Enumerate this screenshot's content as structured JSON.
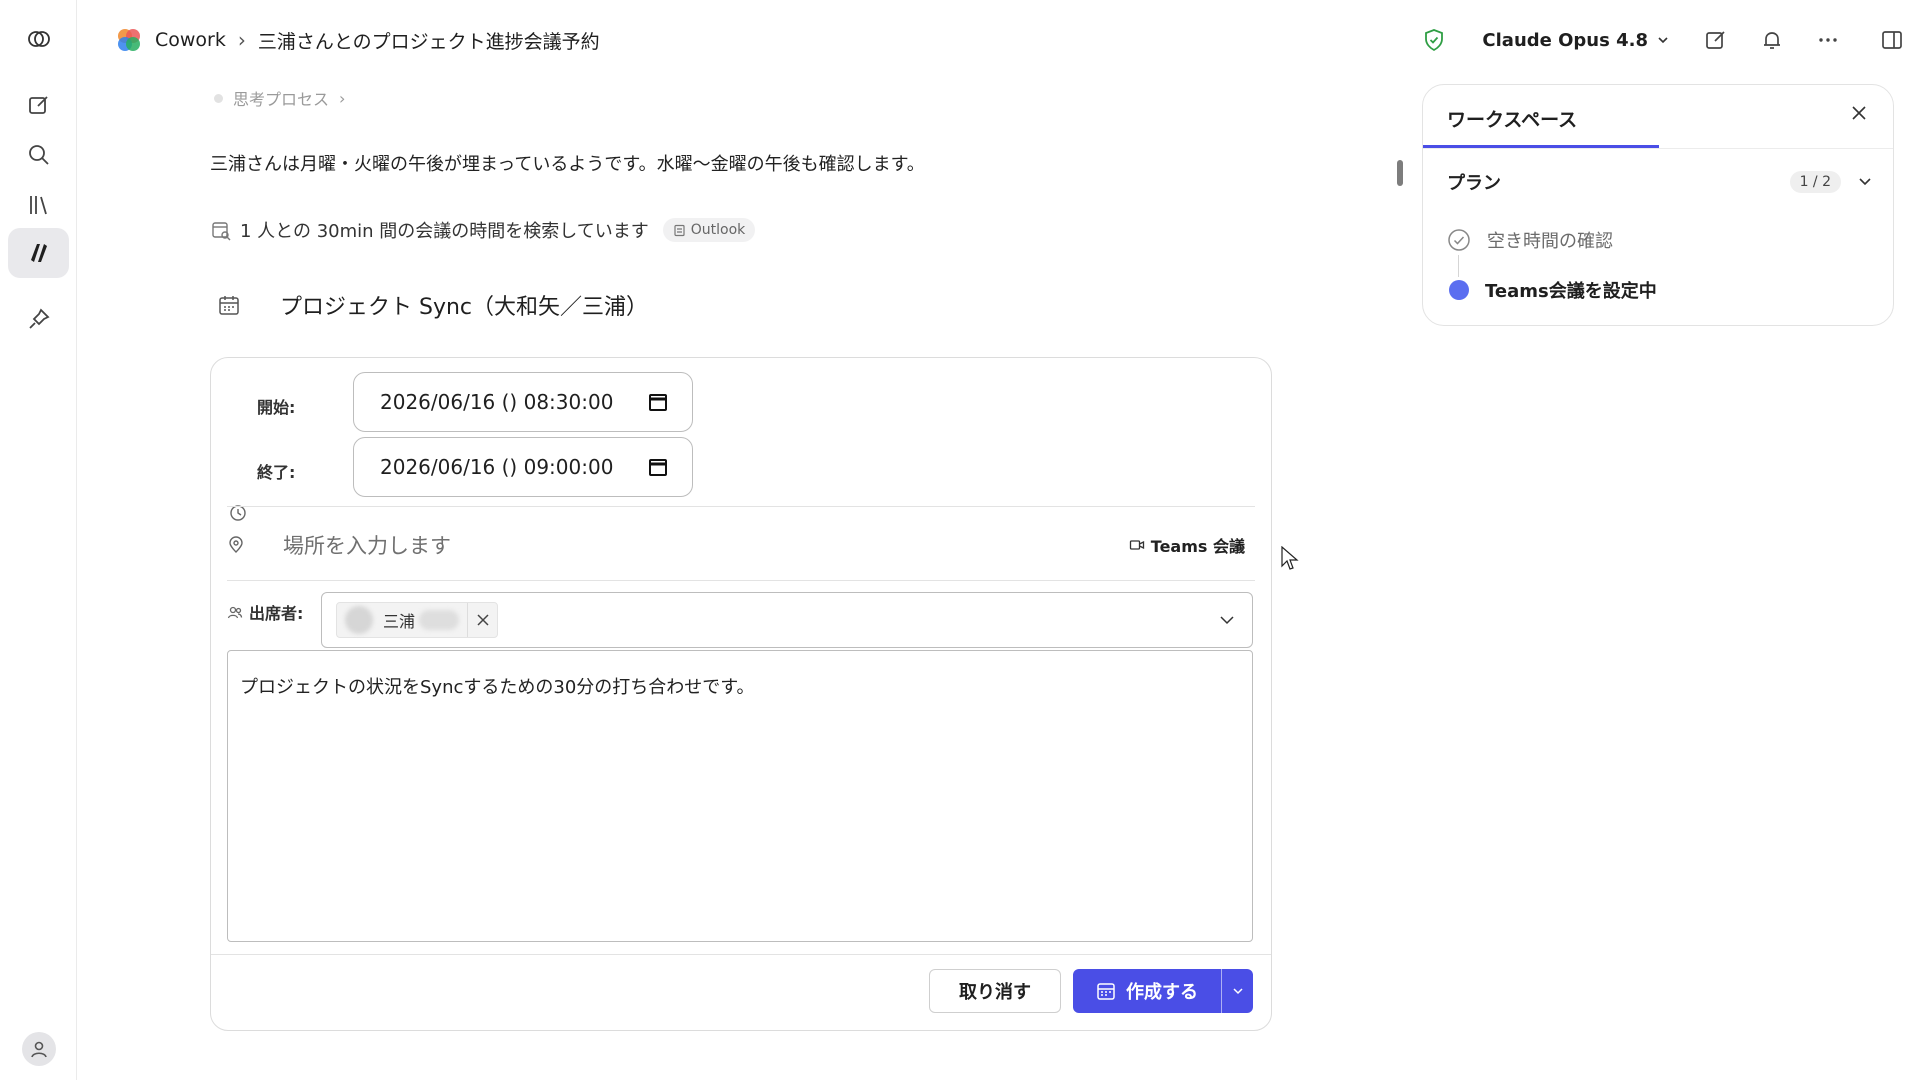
{
  "app": {
    "name": "Cowork",
    "conversation_title": "三浦さんとのプロジェクト進捗会議予約",
    "model": "Claude Opus 4.8"
  },
  "chat": {
    "thinking_label": "思考プロセス",
    "message": "三浦さんは月曜・火曜の午後が埋まっているようです。水曜〜金曜の午後も確認します。",
    "tool_status": "1 人との 30min 間の会議の時間を検索しています",
    "tool_chip": "Outlook"
  },
  "event": {
    "title": "プロジェクト Sync（大和矢／三浦）",
    "start_label": "開始:",
    "start_value": "2026/06/16 () 08:30:00",
    "end_label": "終了:",
    "end_value": "2026/06/16 () 09:00:00",
    "location_placeholder": "場所を入力します",
    "teams_label": "Teams 会議",
    "attendees_label": "出席者:",
    "attendee_name": "三浦",
    "description": "プロジェクトの状況をSyncするための30分の打ち合わせです。",
    "cancel_label": "取り消す",
    "create_label": "作成する"
  },
  "workspace": {
    "title": "ワークスペース",
    "plan_title": "プラン",
    "plan_count": "1 / 2",
    "steps": [
      {
        "label": "空き時間の確認",
        "status": "done"
      },
      {
        "label": "Teams会議を設定中",
        "status": "in-progress"
      }
    ]
  },
  "colors": {
    "accent": "#4a4ee6",
    "step_active": "#5b6ef0",
    "shield": "#2f9e44"
  }
}
